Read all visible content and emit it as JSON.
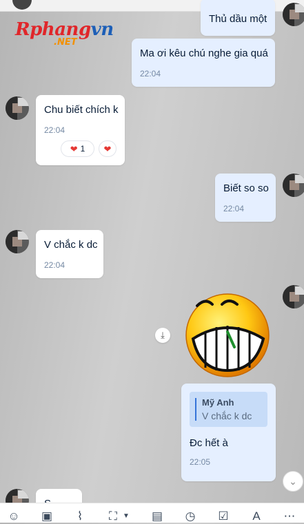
{
  "watermark": {
    "brand_main": "Rphang",
    "brand_accent": "vn",
    "brand_suffix": ".NET"
  },
  "messages": [
    {
      "text": "Thủ dầu một"
    },
    {
      "text": "Ma ơi kêu chú nghe gia quá",
      "time": "22:04"
    },
    {
      "text": "Chu biết chích k",
      "time": "22:04",
      "reactions": [
        {
          "icon": "heart-icon",
          "count": "1"
        },
        {
          "icon": "heart-icon"
        }
      ]
    },
    {
      "text": "Biết so so",
      "time": "22:04"
    },
    {
      "text": "V chắc k dc",
      "time": "22:04"
    },
    {
      "sticker": "grinning-emoji-sticker"
    },
    {
      "reply_to": {
        "name": "Mỹ Anh",
        "text": "V chắc k dc"
      },
      "text": "Đc hết à",
      "time": "22:05"
    },
    {
      "text": "S..."
    }
  ],
  "toolbar": {
    "icons": [
      "sticker-icon",
      "image-icon",
      "attachment-icon",
      "screenshot-icon",
      "dropdown-arrow-icon",
      "contact-card-icon",
      "reminder-clock-icon",
      "task-icon",
      "text-format-icon",
      "more-icon"
    ]
  },
  "colors": {
    "my_bubble": "#e5efff",
    "their_bubble": "#ffffff",
    "time_text": "#7589a3",
    "quote_bar": "#3574d9"
  }
}
